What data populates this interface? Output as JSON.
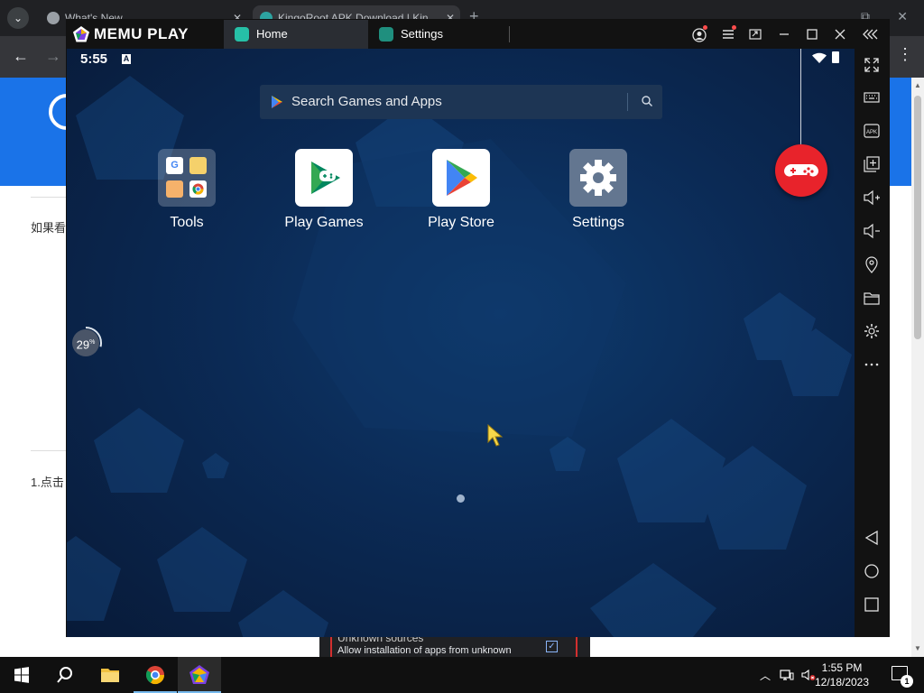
{
  "chrome": {
    "tabs": [
      {
        "title": "What's New"
      },
      {
        "title": "KingoRoot APK Download | Kin"
      }
    ],
    "new_tab": "+",
    "window_controls": [
      "⧉",
      "✕"
    ]
  },
  "webpage": {
    "text1": "如果看",
    "text2": "1.点击"
  },
  "dialog_peek": {
    "title": "Unknown sources",
    "subtitle": "Allow installation of apps from unknown",
    "checked": "✓"
  },
  "memu": {
    "brand": "MEMU PLAY",
    "tabs": [
      {
        "label": "Home"
      },
      {
        "label": "Settings"
      }
    ],
    "title_controls": [
      "account-icon",
      "menu-icon",
      "multi-instance-icon",
      "minimize-icon",
      "maximize-icon",
      "close-icon",
      "collapse-sidebar-icon"
    ],
    "status": {
      "time": "5:55",
      "notification": "A"
    },
    "search": {
      "placeholder": "Search Games and Apps"
    },
    "apps": [
      {
        "label": "Tools"
      },
      {
        "label": "Play Games"
      },
      {
        "label": "Play Store"
      },
      {
        "label": "Settings"
      }
    ],
    "progress": {
      "value": "29",
      "unit": "%",
      "fraction": 0.29
    },
    "sidebar": [
      "fullscreen-icon",
      "keyboard-mapping-icon",
      "apk-install-icon",
      "add-instance-icon",
      "volume-up-icon",
      "volume-down-icon",
      "location-icon",
      "shared-folder-icon",
      "settings-icon",
      "more-icon",
      "back-icon",
      "home-icon",
      "recent-apps-icon"
    ],
    "sidebar_apk": "APK"
  },
  "taskbar": {
    "time": "1:55 PM",
    "date": "12/18/2023",
    "notification_count": "1"
  },
  "colors": {
    "memu_bg": "#081a38",
    "gamepad_red": "#e8232b",
    "chrome_dark": "#202124",
    "taskbar": "#101010"
  }
}
